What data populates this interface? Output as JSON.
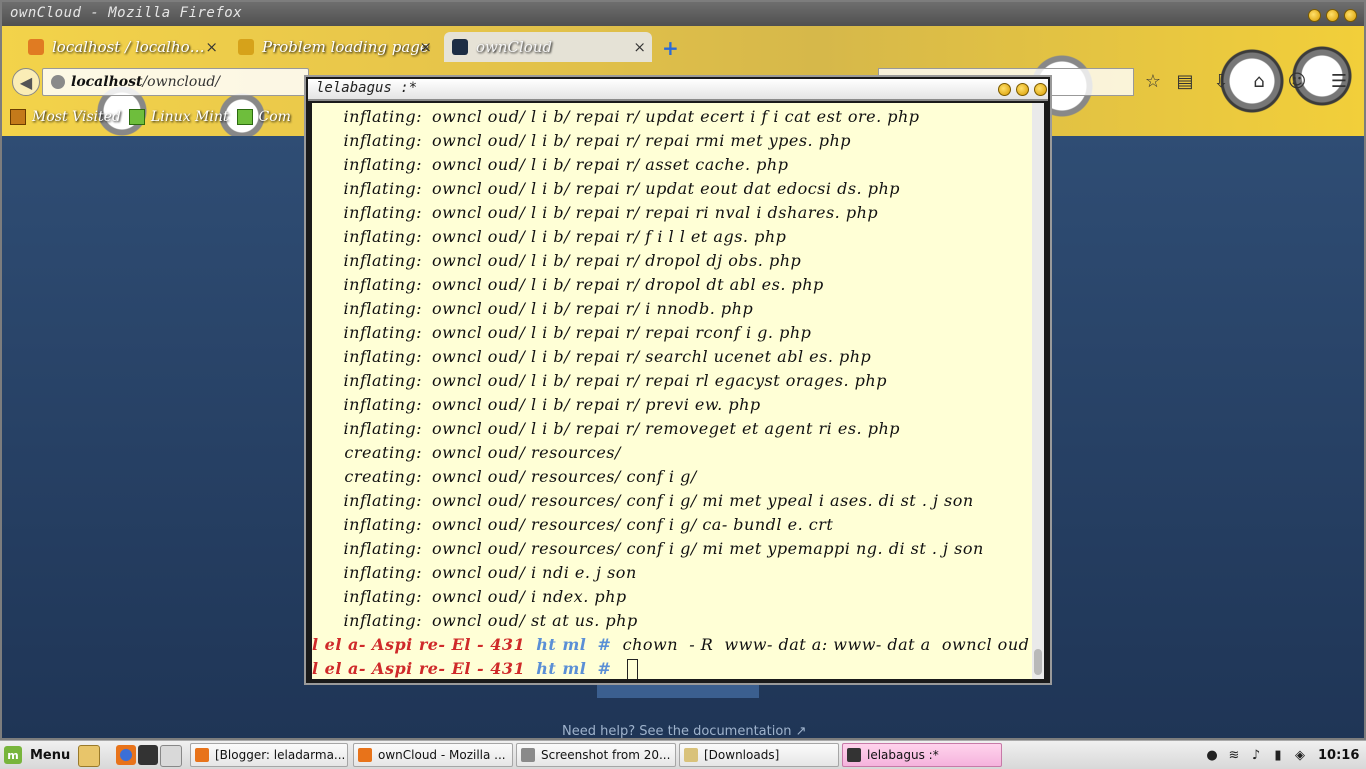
{
  "firefox": {
    "window_title": "ownCloud - Mozilla Firefox",
    "tabs": [
      {
        "label": "localhost / localho…"
      },
      {
        "label": "Problem loading page"
      },
      {
        "label": "ownCloud"
      }
    ],
    "url": {
      "host": "localhost",
      "path": "/owncloud/"
    },
    "bookmarks": [
      {
        "label": "Most Visited"
      },
      {
        "label": "Linux Mint"
      },
      {
        "label": "Com"
      }
    ],
    "page": {
      "help_text": "Need help? See the documentation ↗"
    }
  },
  "terminal": {
    "title": "lelabagus :*",
    "lines": [
      {
        "action": "inflating:",
        "path": "owncl oud/ l i b/ repai r/ updat ecert i f i cat est ore. php"
      },
      {
        "action": "inflating:",
        "path": "owncl oud/ l i b/ repai r/ repai rmi met ypes. php"
      },
      {
        "action": "inflating:",
        "path": "owncl oud/ l i b/ repai r/ asset cache. php"
      },
      {
        "action": "inflating:",
        "path": "owncl oud/ l i b/ repai r/ updat eout dat edocsi ds. php"
      },
      {
        "action": "inflating:",
        "path": "owncl oud/ l i b/ repai r/ repai ri nval i dshares. php"
      },
      {
        "action": "inflating:",
        "path": "owncl oud/ l i b/ repai r/ f i l l et ags. php"
      },
      {
        "action": "inflating:",
        "path": "owncl oud/ l i b/ repai r/ dropol dj obs. php"
      },
      {
        "action": "inflating:",
        "path": "owncl oud/ l i b/ repai r/ dropol dt abl es. php"
      },
      {
        "action": "inflating:",
        "path": "owncl oud/ l i b/ repai r/ i nnodb. php"
      },
      {
        "action": "inflating:",
        "path": "owncl oud/ l i b/ repai r/ repai rconf i g. php"
      },
      {
        "action": "inflating:",
        "path": "owncl oud/ l i b/ repai r/ searchl ucenet abl es. php"
      },
      {
        "action": "inflating:",
        "path": "owncl oud/ l i b/ repai r/ repai rl egacyst orages. php"
      },
      {
        "action": "inflating:",
        "path": "owncl oud/ l i b/ repai r/ previ ew. php"
      },
      {
        "action": "inflating:",
        "path": "owncl oud/ l i b/ repai r/ removeget et agent ri es. php"
      },
      {
        "action": "creating:",
        "path": "owncl oud/ resources/"
      },
      {
        "action": "creating:",
        "path": "owncl oud/ resources/ conf i g/"
      },
      {
        "action": "inflating:",
        "path": "owncl oud/ resources/ conf i g/ mi met ypeal i ases. di st . j son"
      },
      {
        "action": "inflating:",
        "path": "owncl oud/ resources/ conf i g/ ca- bundl e. crt"
      },
      {
        "action": "inflating:",
        "path": "owncl oud/ resources/ conf i g/ mi met ypemappi ng. di st . j son"
      },
      {
        "action": "inflating:",
        "path": "owncl oud/ i ndi e. j son"
      },
      {
        "action": "inflating:",
        "path": "owncl oud/ i ndex. php"
      },
      {
        "action": "inflating:",
        "path": "owncl oud/ st at us. php"
      }
    ],
    "prompts": [
      {
        "host": "l el a- Aspi re- El - 431",
        "dir": "ht ml",
        "symbol": "#",
        "command": "chown  - R  www- dat a: www- dat a  owncl oud"
      },
      {
        "host": "l el a- Aspi re- El - 431",
        "dir": "ht ml",
        "symbol": "#",
        "command": ""
      }
    ]
  },
  "taskbar": {
    "menu_label": "Menu",
    "tasks": [
      {
        "label": "[Blogger: leladarma..."
      },
      {
        "label": "ownCloud - Mozilla ..."
      },
      {
        "label": "Screenshot from 20..."
      },
      {
        "label": "[Downloads]"
      },
      {
        "label": "lelabagus :*"
      }
    ],
    "clock": "10:16"
  },
  "colors": {
    "prompt_host": "#cf2a2a",
    "prompt_dir": "#5a8fd6",
    "terminal_bg": "#ffffd6",
    "active_task": "#f5b3dd"
  }
}
